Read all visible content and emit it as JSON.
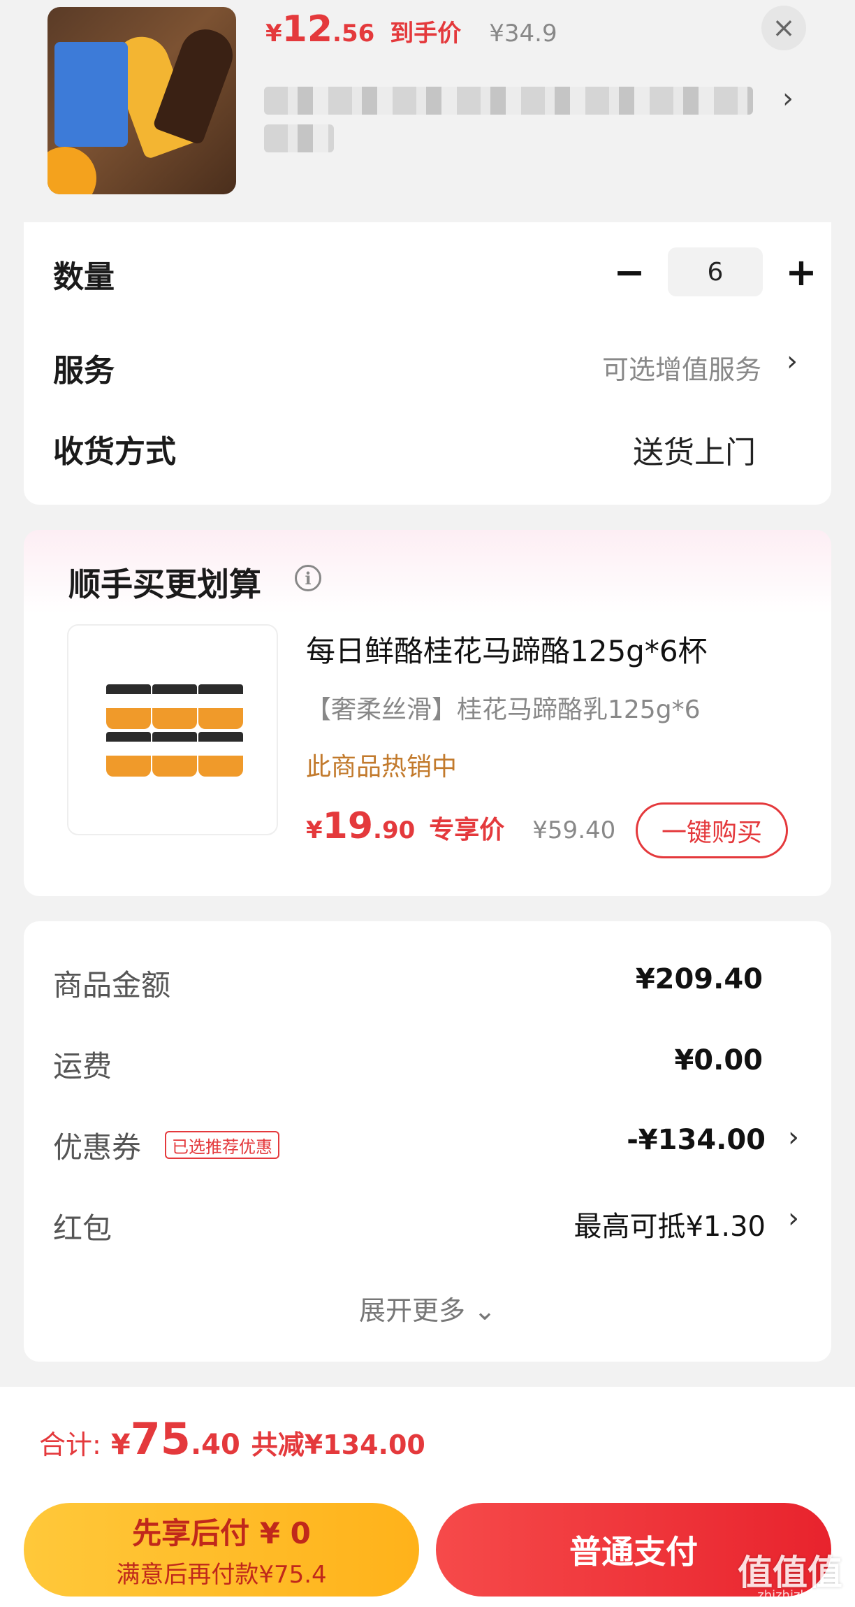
{
  "product": {
    "price_symbol": "¥",
    "price_int": "12",
    "price_dec": ".56",
    "price_tag": "到手价",
    "original_price": "¥34.9",
    "close_icon": "close-icon",
    "chevron_icon": "chevron-right-icon"
  },
  "order": {
    "quantity_label": "数量",
    "quantity_value": "6",
    "minus": "−",
    "plus": "+",
    "service_label": "服务",
    "service_value": "可选增值服务",
    "delivery_label": "收货方式",
    "delivery_value": "送货上门"
  },
  "recommendation": {
    "title": "顺手买更划算",
    "info_icon": "i",
    "name": "每日鲜酪桂花马蹄酪125g*6杯",
    "desc": "【奢柔丝滑】桂花马蹄酪乳125g*6",
    "hot": "此商品热销中",
    "price_symbol": "¥",
    "price_int": "19",
    "price_dec": ".90",
    "price_tag": "专享价",
    "original_price": "¥59.40",
    "buy_label": "一键购买"
  },
  "summary": {
    "goods_label": "商品金额",
    "goods_value": "¥209.40",
    "shipping_label": "运费",
    "shipping_value": "¥0.00",
    "coupon_label": "优惠券",
    "coupon_tag": "已选推荐优惠",
    "coupon_value": "-¥134.00",
    "redpacket_label": "红包",
    "redpacket_value": "最高可抵¥1.30",
    "expand_label": "展开更多 ⌄"
  },
  "total": {
    "label": "合计:",
    "symbol": "¥",
    "int": "75",
    "dec": ".40",
    "saving": "共减¥134.00"
  },
  "pay": {
    "later_line1": "先享后付 ¥ 0",
    "later_line2": "满意后再付款¥75.4",
    "normal": "普通支付"
  },
  "watermark": {
    "text": "值值值",
    "url": "zhizhizhi.com"
  },
  "colors": {
    "accent_red": "#e4393c",
    "pay_later_yellow": "#ffc83a",
    "hot_brown": "#c27a2c"
  }
}
